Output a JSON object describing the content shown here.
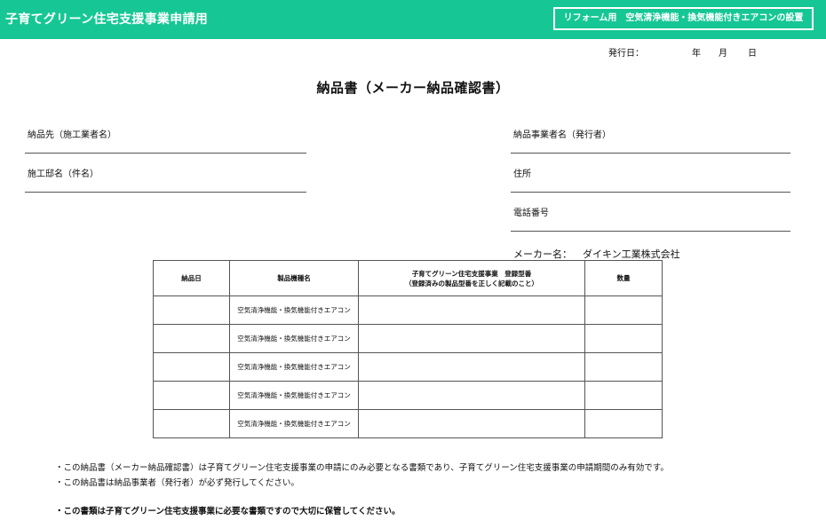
{
  "header": {
    "title": "子育てグリーン住宅支援事業申請用",
    "badge": "リフォーム用　空気清浄機能・換気機能付きエアコンの設置"
  },
  "issue_date": {
    "label": "発行日：",
    "year_unit": "年",
    "month_unit": "月",
    "day_unit": "日"
  },
  "document_title": "納品書（メーカー納品確認書）",
  "fields": {
    "delivery_to": "納品先（施工業者名）",
    "construction_name": "施工邸名（件名）",
    "supplier_name": "納品事業者名（発行者）",
    "address": "住所",
    "phone": "電話番号"
  },
  "maker": {
    "label": "メーカー名：",
    "value": "ダイキン工業株式会社"
  },
  "table": {
    "headers": {
      "delivery_date": "納品日",
      "product_name": "製品機種名",
      "model_number_line1": "子育てグリーン住宅支援事業　登録型番",
      "model_number_line2": "（登録済みの製品型番を正しく記載のこと）",
      "quantity": "数量"
    },
    "rows": [
      {
        "delivery_date": "",
        "product_name": "空気清浄機能・換気機能付きエアコン",
        "model_number": "",
        "quantity": ""
      },
      {
        "delivery_date": "",
        "product_name": "空気清浄機能・換気機能付きエアコン",
        "model_number": "",
        "quantity": ""
      },
      {
        "delivery_date": "",
        "product_name": "空気清浄機能・換気機能付きエアコン",
        "model_number": "",
        "quantity": ""
      },
      {
        "delivery_date": "",
        "product_name": "空気清浄機能・換気機能付きエアコン",
        "model_number": "",
        "quantity": ""
      },
      {
        "delivery_date": "",
        "product_name": "空気清浄機能・換気機能付きエアコン",
        "model_number": "",
        "quantity": ""
      }
    ]
  },
  "notes": [
    "・この納品書（メーカー納品確認書）は子育てグリーン住宅支援事業の申請にのみ必要となる書類であり、子育てグリーン住宅支援事業の申請期間のみ有効です。",
    "・この納品書は納品事業者（発行者）が必ず発行してください。"
  ],
  "important_note": "・この書類は子育てグリーン住宅支援事業に必要な書類ですので大切に保管してください。",
  "colors": {
    "header_bg": "#16c795",
    "header_text": "#ffffff",
    "rule": "#555555"
  }
}
